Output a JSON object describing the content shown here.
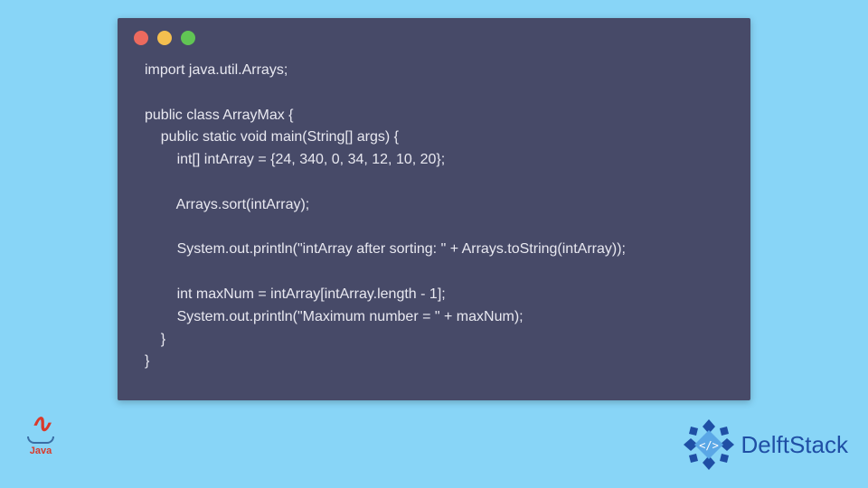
{
  "code_window": {
    "lines": [
      "import java.util.Arrays;",
      "",
      "public class ArrayMax {",
      "    public static void main(String[] args) {",
      "        int[] intArray = {24, 340, 0, 34, 12, 10, 20};",
      "",
      "        Arrays.sort(intArray);",
      "",
      "        System.out.println(\"intArray after sorting: \" + Arrays.toString(intArray));",
      "",
      "        int maxNum = intArray[intArray.length - 1];",
      "        System.out.println(\"Maximum number = \" + maxNum);",
      "    }",
      "}"
    ]
  },
  "java_logo": {
    "label": "Java"
  },
  "delft": {
    "label": "DelftStack"
  },
  "colors": {
    "page_bg": "#88d5f7",
    "window_bg": "#474A68",
    "code_fg": "#e8e8f0",
    "dot_red": "#ec6a5e",
    "dot_yellow": "#f4bf4f",
    "dot_green": "#61c554",
    "delft_blue": "#1f4fa5",
    "java_red": "#d93a2b"
  }
}
